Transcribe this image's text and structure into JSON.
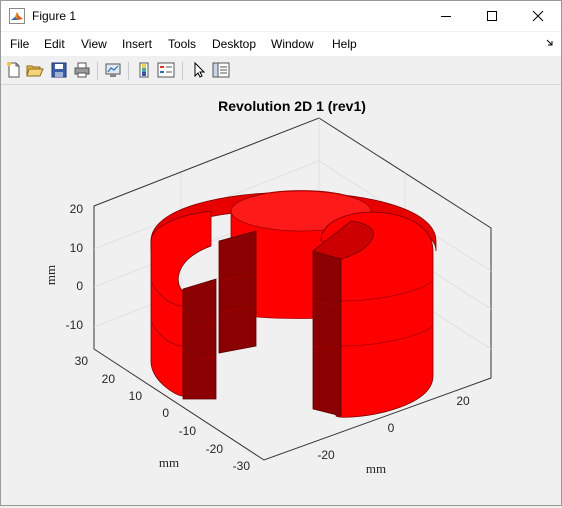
{
  "window": {
    "title": "Figure 1"
  },
  "menu": [
    "File",
    "Edit",
    "View",
    "Insert",
    "Tools",
    "Desktop",
    "Window",
    "Help"
  ],
  "toolbar_icons": [
    "new-figure-icon",
    "open-file-icon",
    "save-icon",
    "print-icon",
    "link-plot-icon",
    "colorbar-icon",
    "legend-icon",
    "pointer-icon",
    "property-inspector-icon"
  ],
  "plot": {
    "title": "Revolution 2D 1 (rev1)",
    "z_label": "mm",
    "y_label": "mm",
    "x_label": "mm",
    "z_ticks": [
      "20",
      "10",
      "0",
      "-10"
    ],
    "y_ticks": [
      "30",
      "20",
      "10",
      "0",
      "-10",
      "-20",
      "-30"
    ],
    "x_ticks": [
      "-20",
      "0",
      "20"
    ],
    "surface_color": "#ff0000",
    "shadow_color": "#8b0000"
  }
}
